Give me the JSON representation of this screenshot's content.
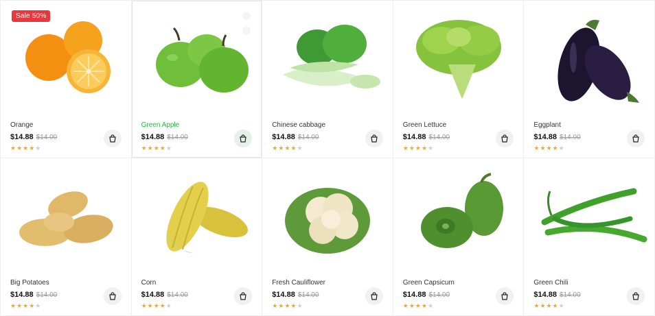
{
  "products": [
    {
      "name": "Orange",
      "price": "$14.88",
      "old_price": "$14.00",
      "rating": 4,
      "badge": "Sale 50%",
      "highlight": false,
      "cart_icon": "shopping-bag-icon"
    },
    {
      "name": "Green Apple",
      "price": "$14.88",
      "old_price": "$14.00",
      "rating": 4,
      "highlight": true,
      "cart_icon": "shopping-bag-icon"
    },
    {
      "name": "Chinese cabbage",
      "price": "$14.88",
      "old_price": "$14.00",
      "rating": 4,
      "highlight": false,
      "cart_icon": "shopping-bag-icon"
    },
    {
      "name": "Green Lettuce",
      "price": "$14.88",
      "old_price": "$14.00",
      "rating": 4,
      "highlight": false,
      "cart_icon": "shopping-bag-icon"
    },
    {
      "name": "Eggplant",
      "price": "$14.88",
      "old_price": "$14.00",
      "rating": 4,
      "highlight": false,
      "cart_icon": "shopping-bag-icon"
    },
    {
      "name": "Big Potatoes",
      "price": "$14.88",
      "old_price": "$14.00",
      "rating": 4,
      "highlight": false,
      "cart_icon": "shopping-bag-icon"
    },
    {
      "name": "Corn",
      "price": "$14.88",
      "old_price": "$14.00",
      "rating": 4,
      "highlight": false,
      "cart_icon": "shopping-bag-icon"
    },
    {
      "name": "Fresh Cauliflower",
      "price": "$14.88",
      "old_price": "$14.00",
      "rating": 4,
      "highlight": false,
      "cart_icon": "shopping-bag-icon"
    },
    {
      "name": "Green Capsicum",
      "price": "$14.88",
      "old_price": "$14.00",
      "rating": 4,
      "highlight": false,
      "cart_icon": "shopping-bag-icon"
    },
    {
      "name": "Green Chili",
      "price": "$14.88",
      "old_price": "$14.00",
      "rating": 4,
      "highlight": false,
      "cart_icon": "shopping-bag-icon"
    }
  ],
  "colors": {
    "accent": "#2bb24c",
    "sale": "#e8383d",
    "star": "#f6a821"
  }
}
